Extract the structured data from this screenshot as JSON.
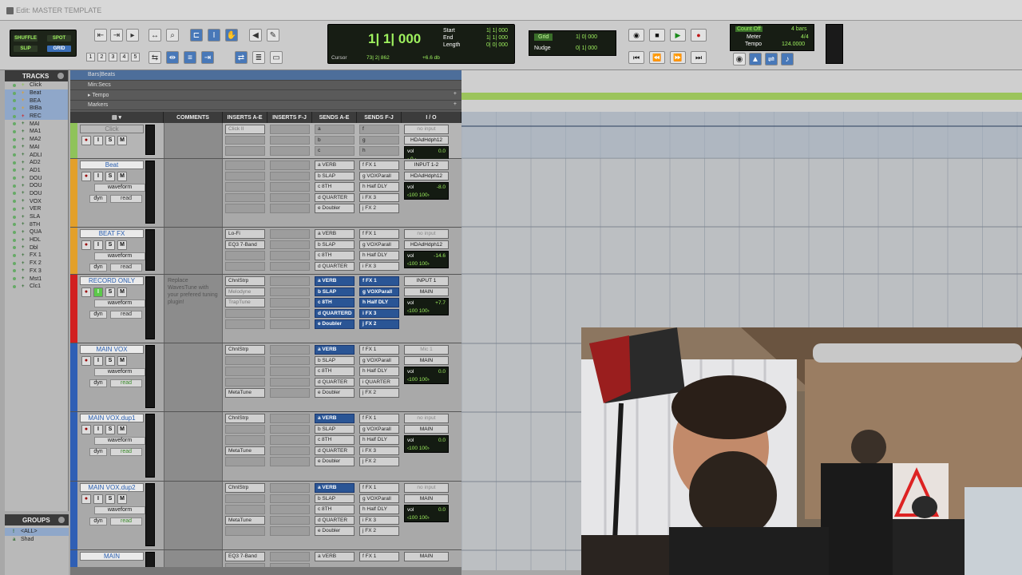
{
  "window": {
    "title": "Edit: MASTER TEMPLATE"
  },
  "toolbar": {
    "modes": [
      "SHUFFLE",
      "SPOT",
      "SLIP",
      "GRID"
    ],
    "zoom_presets": [
      "1",
      "2",
      "3",
      "4",
      "5"
    ],
    "counter": {
      "main": "1| 1| 000",
      "start_label": "Start",
      "start": "1| 1| 000",
      "end_label": "End",
      "end": "1| 1| 000",
      "length_label": "Length",
      "length": "0| 0| 000",
      "cursor_label": "Cursor",
      "cursor": "73| 2| 862",
      "cursor_db": "+6.6 db"
    },
    "grid": {
      "label": "Grid",
      "value": "1| 0| 000"
    },
    "nudge": {
      "label": "Nudge",
      "value": "0| 1| 000"
    },
    "countoff": {
      "label": "Count Off",
      "bars": "4 bars",
      "meter_label": "Meter",
      "meter": "4/4",
      "tempo_label": "Tempo",
      "tempo": "124.0000"
    }
  },
  "tracklist": {
    "header": "TRACKS",
    "items": [
      "Click",
      "Beat",
      "BEA",
      "BtBa",
      "REC",
      "MAI",
      "MA1",
      "MA2",
      "MAI",
      "ADLI",
      "AD2",
      "AD1",
      "DOU",
      "DOU",
      "DOU",
      "VOX",
      "VER",
      "SLA",
      "8TH",
      "QUA",
      "HDL",
      "Dbl",
      "FX 1",
      "FX 2",
      "FX 3",
      "Mst1",
      "Clc1"
    ]
  },
  "groups": {
    "header": "GROUPS",
    "items": [
      "<ALL>",
      "Shad"
    ]
  },
  "rulers": [
    "Bars|Beats",
    "Min:Secs",
    "Tempo",
    "Markers"
  ],
  "columns": [
    "COMMENTS",
    "INSERTS A-E",
    "INSERTS F-J",
    "SENDS A-E",
    "SENDS F-J",
    "I / O"
  ],
  "tracks": [
    {
      "name": "Click",
      "comment": "",
      "ins_ae": [
        "Click II"
      ],
      "ins_fj": [],
      "sends_ae": [
        "a",
        "b",
        "c"
      ],
      "sends_fj": [
        "f",
        "g",
        "h"
      ],
      "input": "no input",
      "output": "HDAdHdph12",
      "vol": "0.0",
      "pan": "‹ 0 ›"
    },
    {
      "name": "Beat",
      "comment": "",
      "ins_ae": [],
      "ins_fj": [],
      "sends_ae": [
        "a VERB",
        "b SLAP",
        "c 8TH",
        "d QUARTER",
        "e Doubler"
      ],
      "sends_fj": [
        "f FX 1",
        "g VOXParall",
        "h Half DLY",
        "i FX 3",
        "j FX 2"
      ],
      "input": "INPUT 1-2",
      "output": "HDAdHdph12",
      "vol": "-8.0",
      "pan": "‹100  100›"
    },
    {
      "name": "BEAT FX",
      "comment": "",
      "ins_ae": [
        "Lo-Fi",
        "EQ3 7-Band"
      ],
      "ins_fj": [],
      "sends_ae": [
        "a VERB",
        "b SLAP",
        "c 8TH",
        "d QUARTER"
      ],
      "sends_fj": [
        "f FX 1",
        "g VOXParall",
        "h Half DLY",
        "i FX 3"
      ],
      "input": "no input",
      "output": "HDAdHdph12",
      "vol": "-14.6",
      "pan": "‹100  100›"
    },
    {
      "name": "RECORD ONLY",
      "comment": "Replace WavesTune with your prefered tuning plugin!",
      "ins_ae": [
        "ChnlStrp",
        "Melodyne",
        "TrapTune"
      ],
      "ins_fj": [],
      "sends_ae": [
        "a VERB",
        "b SLAP",
        "c 8TH",
        "d QUARTERD",
        "e Doubler"
      ],
      "sends_fj": [
        "f FX 1",
        "g VOXParall",
        "h Half DLY",
        "i FX 3",
        "j FX 2"
      ],
      "input": "INPUT 1",
      "output": "MAIN",
      "vol": "+7.7",
      "pan": "‹100  100›"
    },
    {
      "name": "MAIN VOX",
      "comment": "",
      "ins_ae": [
        "ChnlStrp",
        "",
        "",
        "",
        "MetaTune"
      ],
      "ins_fj": [],
      "sends_ae": [
        "a VERB",
        "b SLAP",
        "c 8TH",
        "d QUARTER",
        "e Doubler"
      ],
      "sends_fj": [
        "f FX 1",
        "g VOXParall",
        "h Half DLY",
        "i QUARTER",
        "j FX 2"
      ],
      "input": "Mic 1",
      "output": "MAIN",
      "vol": "0.0",
      "pan": "‹100  100›"
    },
    {
      "name": "MAIN VOX.dup1",
      "comment": "",
      "ins_ae": [
        "ChnlStrp",
        "",
        "",
        "MetaTune"
      ],
      "ins_fj": [],
      "sends_ae": [
        "a VERB",
        "b SLAP",
        "c 8TH",
        "d QUARTER",
        "e Doubler"
      ],
      "sends_fj": [
        "f FX 1",
        "g VOXParall",
        "h Half DLY",
        "i FX 3",
        "j FX 2"
      ],
      "input": "no input",
      "output": "MAIN",
      "vol": "0.0",
      "pan": "‹100  100›"
    },
    {
      "name": "MAIN VOX.dup2",
      "comment": "",
      "ins_ae": [
        "ChnlStrp",
        "",
        "",
        "MetaTune"
      ],
      "ins_fj": [],
      "sends_ae": [
        "a VERB",
        "b SLAP",
        "c 8TH",
        "d QUARTER",
        "e Doubler"
      ],
      "sends_fj": [
        "f FX 1",
        "g VOXParall",
        "h Half DLY",
        "i FX 3",
        "j FX 2"
      ],
      "input": "no input",
      "output": "MAIN",
      "vol": "0.0",
      "pan": "‹100  100›"
    },
    {
      "name": "MAIN",
      "comment": "",
      "ins_ae": [
        "EQ3 7-Band"
      ],
      "ins_fj": [],
      "sends_ae": [
        "a VERB"
      ],
      "sends_fj": [
        "f FX 1"
      ],
      "input": "MAIN",
      "output": "",
      "vol": "",
      "pan": ""
    }
  ],
  "labels": {
    "vol": "vol",
    "waveform": "waveform",
    "dyn": "dyn",
    "read": "read",
    "wave": "wave"
  },
  "colors": {
    "beat": "#e3a02a",
    "record": "#d22020",
    "vocals": "#2f5fb5",
    "click": "#8fc35a",
    "accent": "#9ef05e"
  }
}
